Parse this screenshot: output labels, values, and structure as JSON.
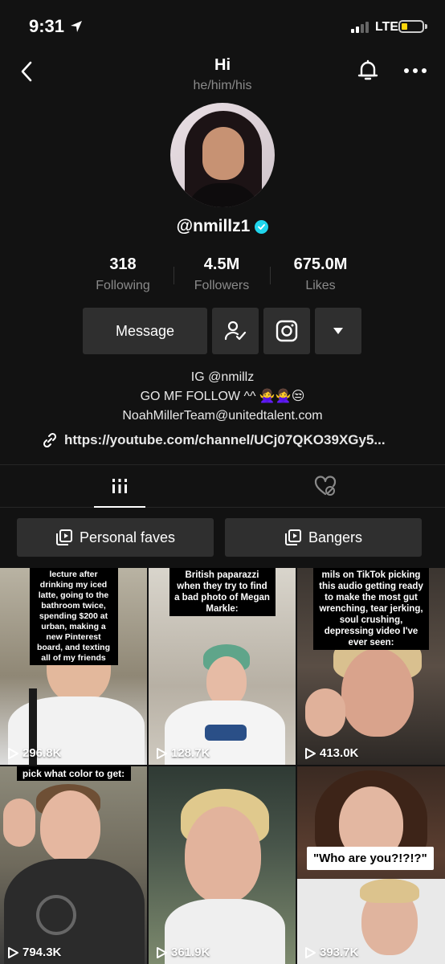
{
  "status_bar": {
    "time": "9:31",
    "network": "LTE",
    "battery_color": "#ffd60a"
  },
  "header": {
    "title": "Hi",
    "pronouns": "he/him/his"
  },
  "profile": {
    "username": "@nmillz1",
    "verified_color": "#20d5ec"
  },
  "stats": [
    {
      "value": "318",
      "label": "Following"
    },
    {
      "value": "4.5M",
      "label": "Followers"
    },
    {
      "value": "675.0M",
      "label": "Likes"
    }
  ],
  "actions": {
    "message_label": "Message"
  },
  "bio": {
    "line1": "IG @nmillz",
    "line2": "GO MF FOLLOW ^^ 🙅‍♀️🙅‍♀️😒",
    "line3": "NoahMillerTeam@unitedtalent.com",
    "link": "https://youtube.com/channel/UCj07QKO39XGy5..."
  },
  "playlists": [
    {
      "label": "Personal faves"
    },
    {
      "label": "Bangers"
    }
  ],
  "videos": [
    {
      "caption": "lecture after drinking my iced latte, going to the bathroom twice, spending $200 at urban, making a new Pinterest board, and texting all of my friends",
      "views": "296.8K"
    },
    {
      "caption": "British paparazzi when they try to find a bad photo of Megan Markle:",
      "views": "128.7K"
    },
    {
      "caption": "mils on TikTok picking this audio getting ready to make the most gut wrenching, tear jerking, soul crushing, depressing video I've ever seen:",
      "views": "413.0K"
    },
    {
      "caption": "pick what color to get:",
      "views": "794.3K"
    },
    {
      "caption": "",
      "views": "361.9K"
    },
    {
      "caption": "\"Who are you?!?!?\"",
      "views": "393.7K"
    }
  ]
}
